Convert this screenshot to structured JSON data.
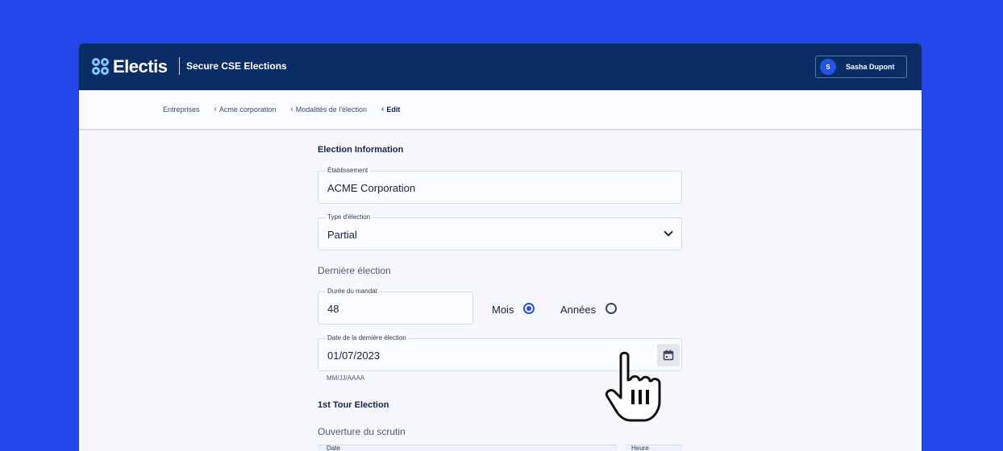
{
  "header": {
    "logo_text": "Electis",
    "app_title": "Secure CSE Elections",
    "user": {
      "initial": "S",
      "name": "Sasha Dupont"
    }
  },
  "breadcrumb": [
    {
      "label": "Entreprises"
    },
    {
      "label": "Acme corporation"
    },
    {
      "label": "Modalités de l'élection"
    },
    {
      "label": "Edit"
    }
  ],
  "form": {
    "section_info": "Election Information",
    "etablissement": {
      "label": "Établissement",
      "value": "ACME Corporation"
    },
    "type_election": {
      "label": "Type d'élection",
      "value": "Partial"
    },
    "derniere_election": "Dernière élection",
    "duree_mandat": {
      "label": "Durée du mandat",
      "value": "48"
    },
    "unit_options": [
      {
        "label": "Mois",
        "selected": true
      },
      {
        "label": "Années",
        "selected": false
      }
    ],
    "date_derniere": {
      "label": "Date de la dernière élection",
      "value": "01/07/2023",
      "hint": "MM/JJ/AAAA"
    },
    "section_tour": "1st Tour Election",
    "ouverture": "Ouverture du scrutin",
    "date_label": "Date",
    "heure_label": "Heure"
  },
  "colors": {
    "background": "#2447e9",
    "header": "#0a2d66",
    "accent": "#2a4de0"
  }
}
